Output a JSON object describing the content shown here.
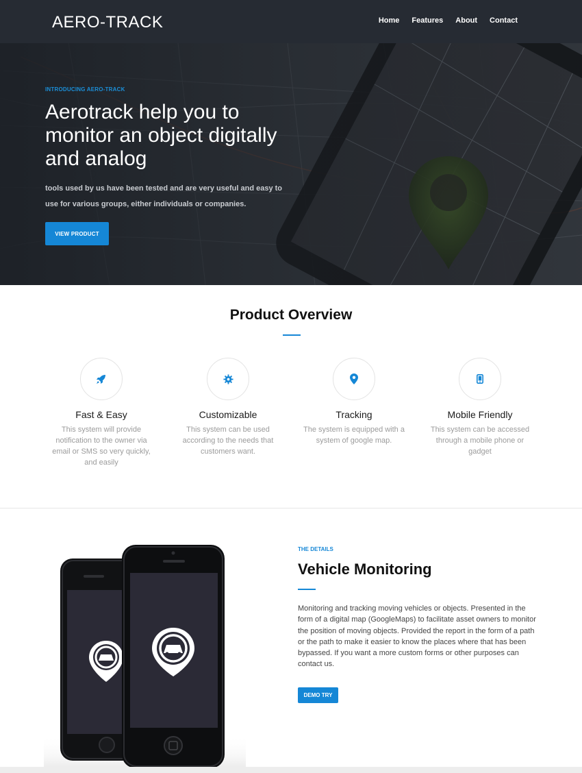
{
  "nav": {
    "brand": "AERO-TRACK",
    "links": [
      "Home",
      "Features",
      "About",
      "Contact"
    ]
  },
  "hero": {
    "eyebrow": "INTRODUCING AERO-TRACK",
    "title": "Aerotrack help you to monitor an object digitally and analog",
    "subtitle": "tools used by us have been tested and are very useful and easy to use for various groups, either individuals or companies.",
    "button": "VIEW PRODUCT"
  },
  "overview": {
    "title": "Product Overview",
    "features": [
      {
        "icon": "rocket-icon",
        "title": "Fast & Easy",
        "desc": "This system will provide notification to the owner via email or SMS so very quickly, and easily"
      },
      {
        "icon": "gear-icon",
        "title": "Customizable",
        "desc": "This system can be used according to the needs that customers want."
      },
      {
        "icon": "map-pin-icon",
        "title": "Tracking",
        "desc": "The system is equipped with a system of google map."
      },
      {
        "icon": "mobile-icon",
        "title": "Mobile Friendly",
        "desc": "This system can be accessed through a mobile phone or gadget"
      }
    ]
  },
  "details": {
    "eyebrow": "THE DETAILS",
    "title": "Vehicle Monitoring",
    "body": "Monitoring and tracking moving vehicles or objects. Presented in the form of a digital map (GoogleMaps) to facilitate asset owners to monitor the position of moving objects. Provided the report in the form of a path or the path to make it easier to know the places where that has been bypassed. If you want a more custom forms or other purposes can contact us.",
    "button": "DEMO TRY"
  },
  "colors": {
    "accent": "#1587d6",
    "nav_bg": "#262b33",
    "hero_bg": "#20242a"
  }
}
